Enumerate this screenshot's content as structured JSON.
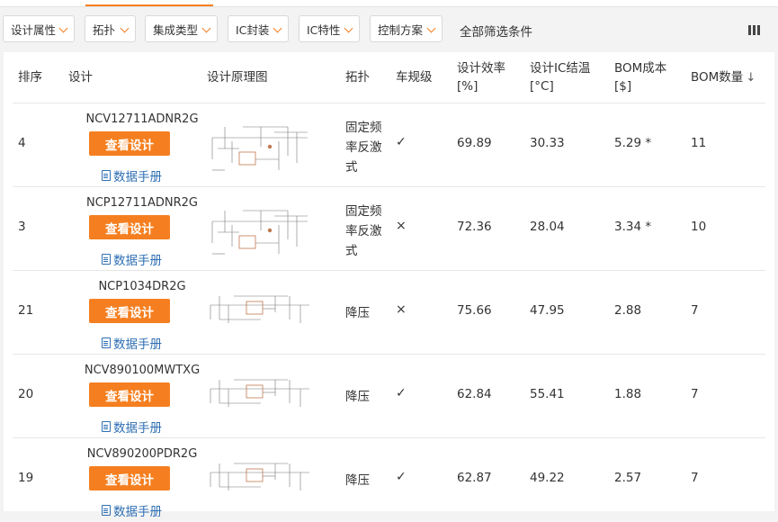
{
  "filters": [
    {
      "label": "设计属性"
    },
    {
      "label": "拓扑"
    },
    {
      "label": "集成类型"
    },
    {
      "label": "IC封装"
    },
    {
      "label": "IC特性"
    },
    {
      "label": "控制方案"
    }
  ],
  "all_filters_label": "全部筛选条件",
  "column_settings_icon": "columns-icon",
  "headers": {
    "rank": "排序",
    "design": "设计",
    "schematic": "设计原理图",
    "topology": "拓扑",
    "automotive": "车规级",
    "efficiency_l1": "设计效率",
    "efficiency_l2": "[%]",
    "ic_temp_l1": "设计IC结温",
    "ic_temp_l2": "[°C]",
    "bom_cost_l1": "BOM成本",
    "bom_cost_l2": "[$]",
    "bom_count": "BOM数量",
    "sort_arrow": "↓"
  },
  "view_design_label": "查看设计",
  "datasheet_label": "数据手册",
  "accent_color": "#f57f20",
  "rows": [
    {
      "rank": "4",
      "part": "NCV12711ADNR2G",
      "topology_lines": [
        "固定频",
        "率反激",
        "式"
      ],
      "automotive": "✓",
      "efficiency": "69.89",
      "ic_temp": "30.33",
      "bom_cost": "5.29 *",
      "bom_count": "11"
    },
    {
      "rank": "3",
      "part": "NCP12711ADNR2G",
      "topology_lines": [
        "固定频",
        "率反激",
        "式"
      ],
      "automotive": "×",
      "efficiency": "72.36",
      "ic_temp": "28.04",
      "bom_cost": "3.34 *",
      "bom_count": "10"
    },
    {
      "rank": "21",
      "part": "NCP1034DR2G",
      "topology_lines": [
        "降压"
      ],
      "automotive": "×",
      "efficiency": "75.66",
      "ic_temp": "47.95",
      "bom_cost": "2.88",
      "bom_count": "7"
    },
    {
      "rank": "20",
      "part": "NCV890100MWTXG",
      "topology_lines": [
        "降压"
      ],
      "automotive": "✓",
      "efficiency": "62.84",
      "ic_temp": "55.41",
      "bom_cost": "1.88",
      "bom_count": "7"
    },
    {
      "rank": "19",
      "part": "NCV890200PDR2G",
      "topology_lines": [
        "降压"
      ],
      "automotive": "✓",
      "efficiency": "62.87",
      "ic_temp": "49.22",
      "bom_cost": "2.57",
      "bom_count": "7"
    }
  ]
}
